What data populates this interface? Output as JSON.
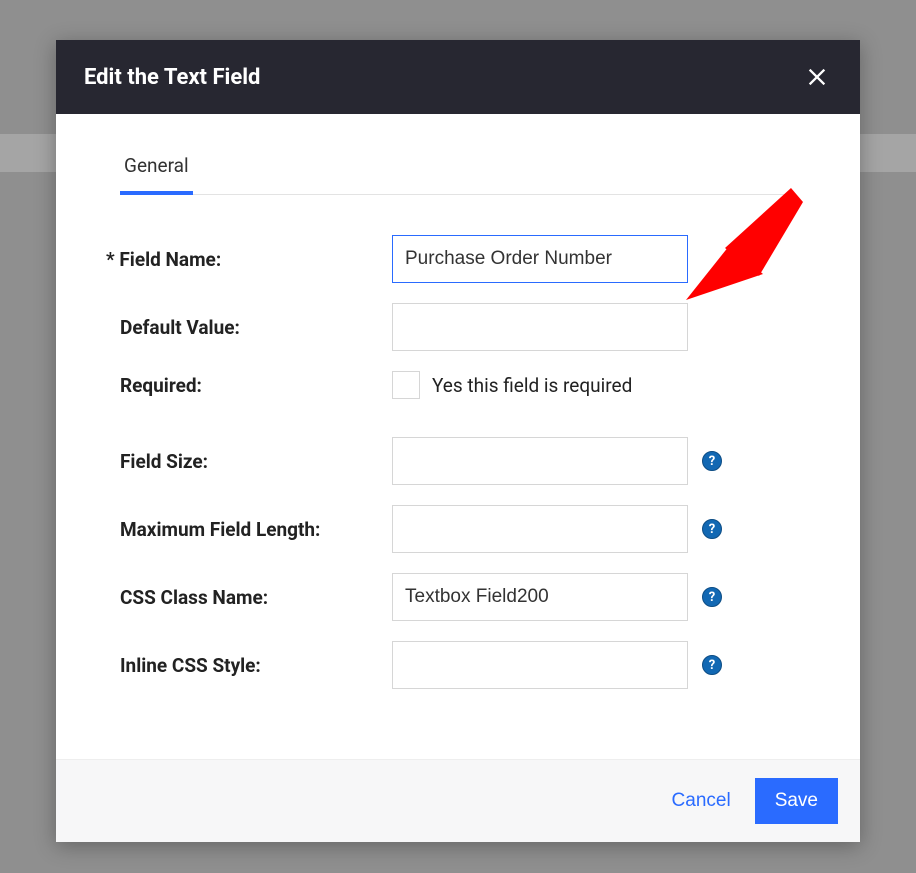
{
  "modal": {
    "title": "Edit the Text Field",
    "tabs": [
      {
        "label": "General"
      }
    ],
    "fields": {
      "field_name": {
        "label": "Field Name:",
        "value": "Purchase Order Number"
      },
      "default_value": {
        "label": "Default Value:",
        "value": ""
      },
      "required": {
        "label": "Required:",
        "checkbox_label": "Yes this field is required",
        "checked": false
      },
      "field_size": {
        "label": "Field Size:",
        "value": ""
      },
      "max_length": {
        "label": "Maximum Field Length:",
        "value": ""
      },
      "css_class": {
        "label": "CSS Class Name:",
        "value": "Textbox Field200"
      },
      "inline_css": {
        "label": "Inline CSS Style:",
        "value": ""
      }
    },
    "footer": {
      "cancel": "Cancel",
      "save": "Save"
    },
    "help_glyph": "?"
  }
}
